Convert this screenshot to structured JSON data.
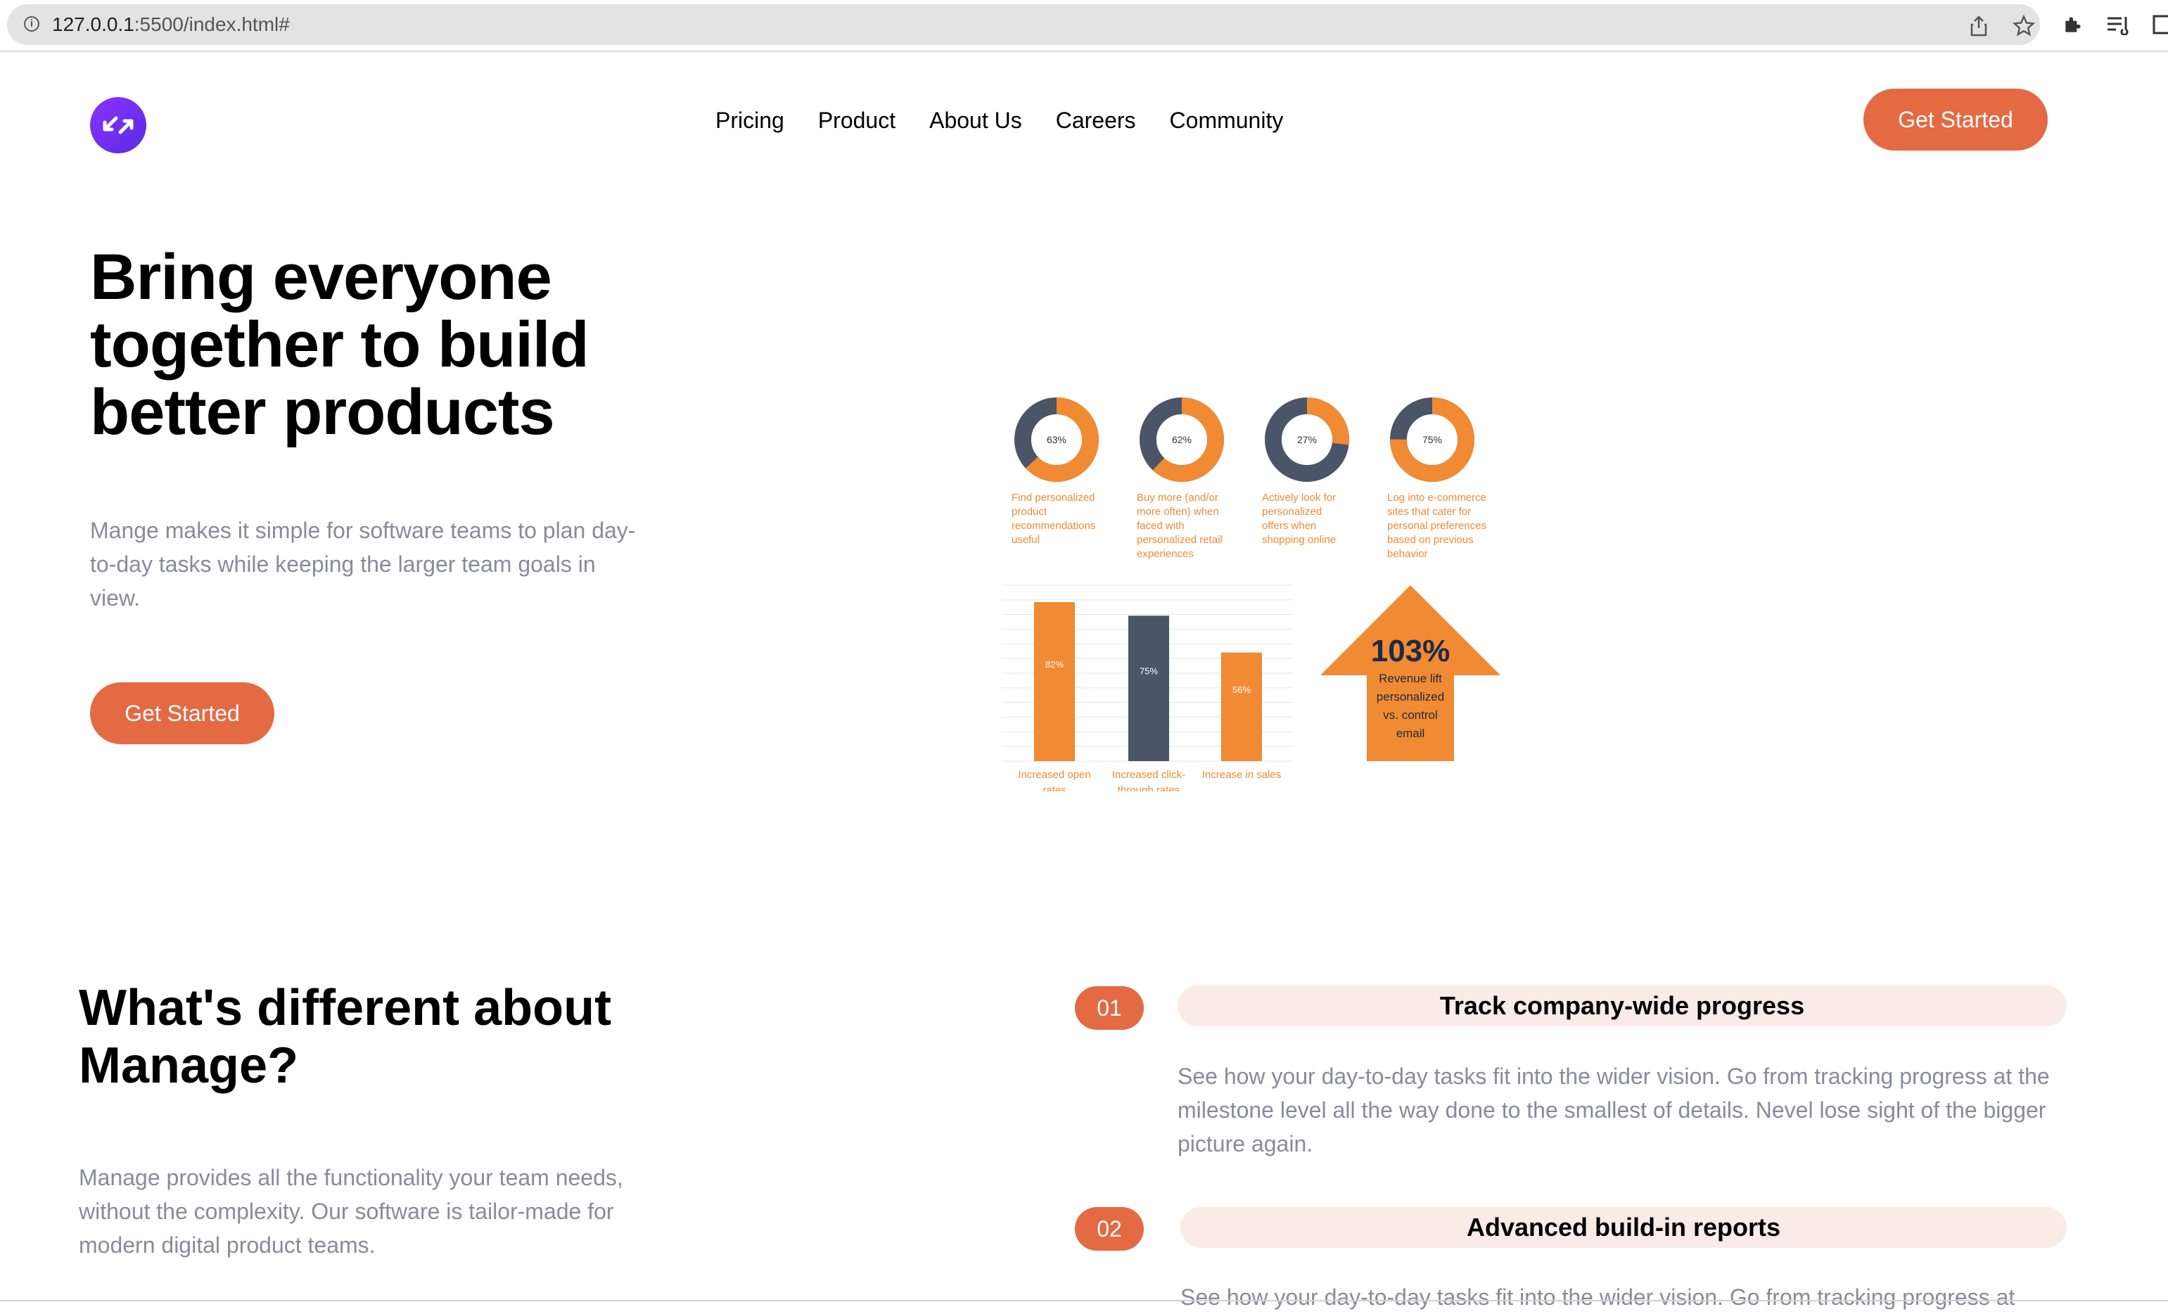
{
  "browser": {
    "url_host": "127.0.0.1",
    "url_path": ":5500/index.html#"
  },
  "nav": {
    "links": [
      "Pricing",
      "Product",
      "About Us",
      "Careers",
      "Community"
    ],
    "cta": "Get Started"
  },
  "hero": {
    "title": "Bring everyone together to build better products",
    "description": "Mange makes it simple for software teams to plan day-to-day tasks while keeping the larger team goals in view.",
    "cta": "Get Started"
  },
  "infographic": {
    "donuts": [
      {
        "value": 63,
        "label": "63%",
        "caption": [
          "Find personalized",
          "product",
          "recommendations",
          "useful"
        ]
      },
      {
        "value": 62,
        "label": "62%",
        "caption": [
          "Buy more (and/or",
          "more often) when",
          "faced with",
          "personalized retail",
          "experiences"
        ]
      },
      {
        "value": 27,
        "label": "27%",
        "caption": [
          "Actively look for",
          "personalized",
          "offers when",
          "shopping online"
        ]
      },
      {
        "value": 75,
        "label": "75%",
        "caption": [
          "Log into e-commerce",
          "sites that cater for",
          "personal preferences",
          "based on previous",
          "behavior"
        ]
      }
    ],
    "bars": [
      {
        "value": 82,
        "label": "82%",
        "color": "#f08a33",
        "caption": [
          "Increased open",
          "rates"
        ]
      },
      {
        "value": 75,
        "label": "75%",
        "color": "#4a5568",
        "caption": [
          "Increased click-",
          "through rates"
        ]
      },
      {
        "value": 56,
        "label": "56%",
        "color": "#f08a33",
        "caption": [
          "Increase in sales"
        ]
      }
    ],
    "arrow": {
      "value": "103%",
      "caption": [
        "Revenue lift",
        "personalized",
        "vs. control",
        "email"
      ]
    },
    "colors": {
      "orange": "#f08a33",
      "navy": "#4a5568"
    }
  },
  "section": {
    "title": "What's different about Manage?",
    "description": "Manage provides all the functionality your team needs, without the complexity. Our software is tailor-made for modern digital product teams."
  },
  "features": [
    {
      "num": "01",
      "title": "Track company-wide progress",
      "description": "See how your day-to-day tasks fit into the wider vision. Go from tracking progress at the milestone level all the way done to the smallest of details. Nevel lose sight of the bigger picture again."
    },
    {
      "num": "02",
      "title": "Advanced build-in reports",
      "description": "See how your day-to-day tasks fit into the wider vision. Go from tracking progress at"
    }
  ],
  "colors": {
    "accent": "#e36a43",
    "accent_light": "#fbebe6",
    "muted_text": "#8a8a99",
    "logo": "#6a2ff0"
  }
}
